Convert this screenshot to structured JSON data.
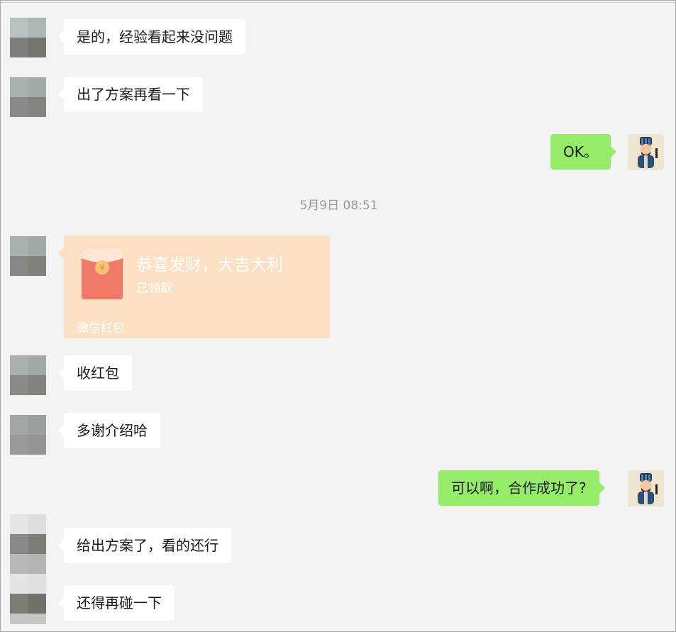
{
  "chat": {
    "timestamp": "5月9日 08:51",
    "messages": [
      {
        "side": "left",
        "text": "是的，经验看起来没问题"
      },
      {
        "side": "left",
        "text": "出了方案再看一下"
      },
      {
        "side": "right",
        "text": "OK。"
      },
      {
        "side": "left",
        "type": "red-packet"
      },
      {
        "side": "left",
        "text": "收红包"
      },
      {
        "side": "left",
        "text": "多谢介绍哈"
      },
      {
        "side": "right",
        "text": "可以啊，合作成功了?"
      },
      {
        "side": "left",
        "text": "给出方案了，看的还行"
      },
      {
        "side": "left",
        "text": "还得再碰一下"
      }
    ],
    "red_packet": {
      "title": "恭喜发财，大吉大利",
      "status": "已领取",
      "footer": "微信红包",
      "coin_symbol": "¥"
    }
  },
  "colors": {
    "background": "#f3f3f3",
    "incoming_bubble": "#ffffff",
    "outgoing_bubble": "#95ec69",
    "red_packet": "#fbe0c3",
    "red_packet_envelope": "#ef7a68"
  },
  "icons": {
    "contact_avatar": "pixelated-avatar-icon",
    "self_avatar": "cartoon-official-avatar-icon"
  }
}
